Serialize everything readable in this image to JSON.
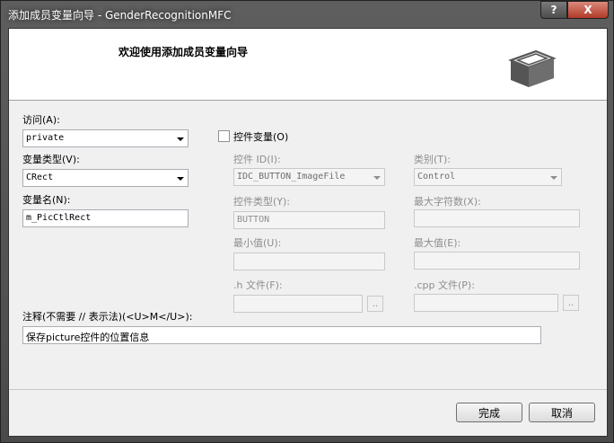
{
  "window": {
    "title": "添加成员变量向导 - GenderRecognitionMFC",
    "help_label": "?",
    "close_label": "X"
  },
  "header": {
    "title": "欢迎使用添加成员变量向导",
    "icon": "box-icon"
  },
  "form": {
    "access_label": "访问(A):",
    "access_value": "private",
    "var_type_label": "变量类型(V):",
    "var_type_value": "CRect",
    "var_name_label": "变量名(N):",
    "var_name_value": "m_PicCtlRect",
    "control_var_label": "控件变量(O)",
    "control_var_checked": false,
    "control_id_label": "控件 ID(I):",
    "control_id_value": "IDC_BUTTON_ImageFile",
    "category_label": "类别(T):",
    "category_value": "Control",
    "control_type_label": "控件类型(Y):",
    "control_type_value": "BUTTON",
    "max_chars_label": "最大字符数(X):",
    "max_chars_value": "",
    "min_label": "最小值(U):",
    "min_value": "",
    "max_label": "最大值(E):",
    "max_value": "",
    "h_file_label": ".h 文件(F):",
    "h_file_value": "",
    "cpp_file_label": ".cpp 文件(P):",
    "cpp_file_value": "",
    "browse_label": "..",
    "comment_label": "注释(不需要 // 表示法)(<U>M</U>):",
    "comment_value": "保存picture控件的位置信息"
  },
  "buttons": {
    "finish": "完成",
    "cancel": "取消"
  }
}
